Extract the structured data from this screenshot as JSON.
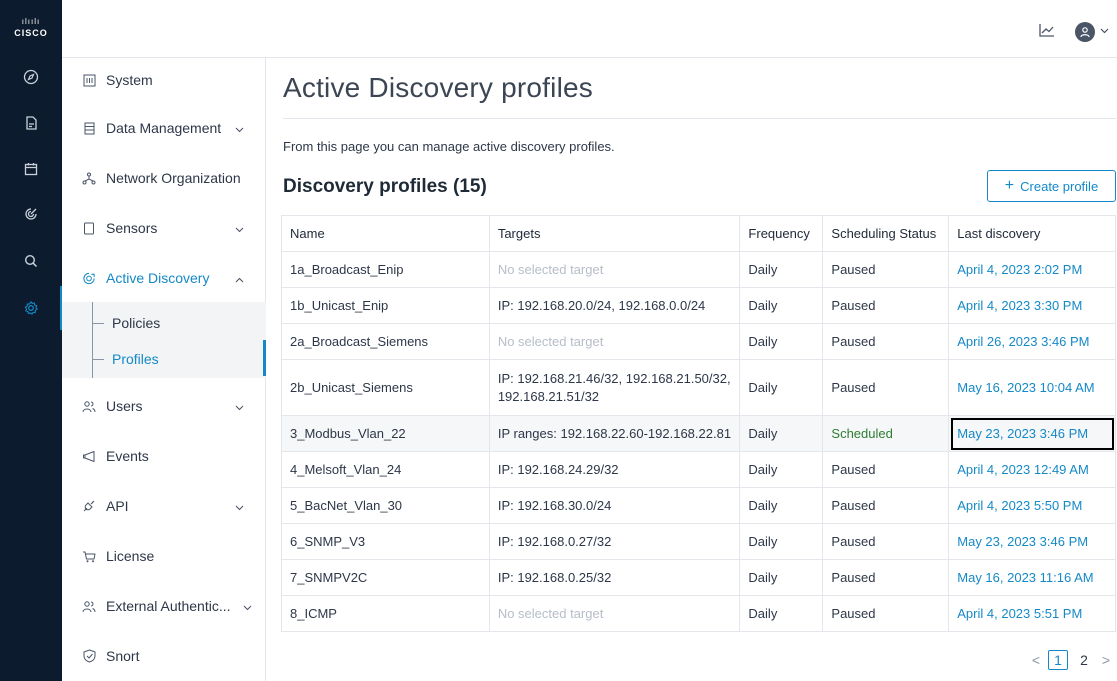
{
  "brand": {
    "logo_bars": "ılıılı",
    "logo_word": "CISCO"
  },
  "rail": {
    "items": [
      {
        "icon": "compass-icon"
      },
      {
        "icon": "document-icon"
      },
      {
        "icon": "calendar-icon"
      },
      {
        "icon": "radar-icon"
      },
      {
        "icon": "search-icon"
      },
      {
        "icon": "gear-icon",
        "active": true
      }
    ]
  },
  "topbar": {
    "chart_icon": "line-chart-icon",
    "avatar_icon": "user-icon",
    "caret": "⌵"
  },
  "submenu": {
    "system": "System",
    "data_management": "Data Management",
    "network_organization": "Network Organization",
    "sensors": "Sensors",
    "active_discovery": "Active Discovery",
    "policies": "Policies",
    "profiles": "Profiles",
    "users": "Users",
    "events": "Events",
    "api": "API",
    "license": "License",
    "external_auth": "External Authentic...",
    "snort": "Snort"
  },
  "main": {
    "title": "Active Discovery profiles",
    "intro": "From this page you can manage active discovery profiles.",
    "section_title": "Discovery profiles (15)",
    "create_button": "Create profile"
  },
  "table": {
    "headers": {
      "name": "Name",
      "targets": "Targets",
      "frequency": "Frequency",
      "scheduling_status": "Scheduling Status",
      "last_discovery": "Last discovery"
    },
    "rows": [
      {
        "name": "1a_Broadcast_Enip",
        "targets": "No selected target",
        "frequency": "Daily",
        "status": "Paused",
        "last": "April 4, 2023 2:02 PM"
      },
      {
        "name": "1b_Unicast_Enip",
        "targets": "IP: 192.168.20.0/24, 192.168.0.0/24",
        "frequency": "Daily",
        "status": "Paused",
        "last": "April 4, 2023 3:30 PM"
      },
      {
        "name": "2a_Broadcast_Siemens",
        "targets": "No selected target",
        "frequency": "Daily",
        "status": "Paused",
        "last": "April 26, 2023 3:46 PM"
      },
      {
        "name": "2b_Unicast_Siemens",
        "targets_line1": "IP: 192.168.21.46/32, 192.168.21.50/32,",
        "targets_line2": "192.168.21.51/32",
        "frequency": "Daily",
        "status": "Paused",
        "last": "May 16, 2023 10:04 AM"
      },
      {
        "name": "3_Modbus_Vlan_22",
        "targets": "IP ranges: 192.168.22.60-192.168.22.81",
        "frequency": "Daily",
        "status": "Scheduled",
        "last": "May 23, 2023 3:46 PM"
      },
      {
        "name": "4_Melsoft_Vlan_24",
        "targets": "IP: 192.168.24.29/32",
        "frequency": "Daily",
        "status": "Paused",
        "last": "April 4, 2023 12:49 AM"
      },
      {
        "name": "5_BacNet_Vlan_30",
        "targets": "IP: 192.168.30.0/24",
        "frequency": "Daily",
        "status": "Paused",
        "last": "April 4, 2023 5:50 PM"
      },
      {
        "name": "6_SNMP_V3",
        "targets": "IP: 192.168.0.27/32",
        "frequency": "Daily",
        "status": "Paused",
        "last": "May 23, 2023 3:46 PM"
      },
      {
        "name": "7_SNMPV2C",
        "targets": "IP: 192.168.0.25/32",
        "frequency": "Daily",
        "status": "Paused",
        "last": "May 16, 2023 11:16 AM"
      },
      {
        "name": "8_ICMP",
        "targets": "No selected target",
        "frequency": "Daily",
        "status": "Paused",
        "last": "April 4, 2023 5:51 PM"
      }
    ]
  },
  "pagination": {
    "prev": "<",
    "page1": "1",
    "page2": "2",
    "next": ">"
  },
  "colors": {
    "accent": "#1589c7",
    "rail": "#0d1b2e",
    "scheduled": "#2e7d32",
    "muted": "#b6bec8"
  }
}
